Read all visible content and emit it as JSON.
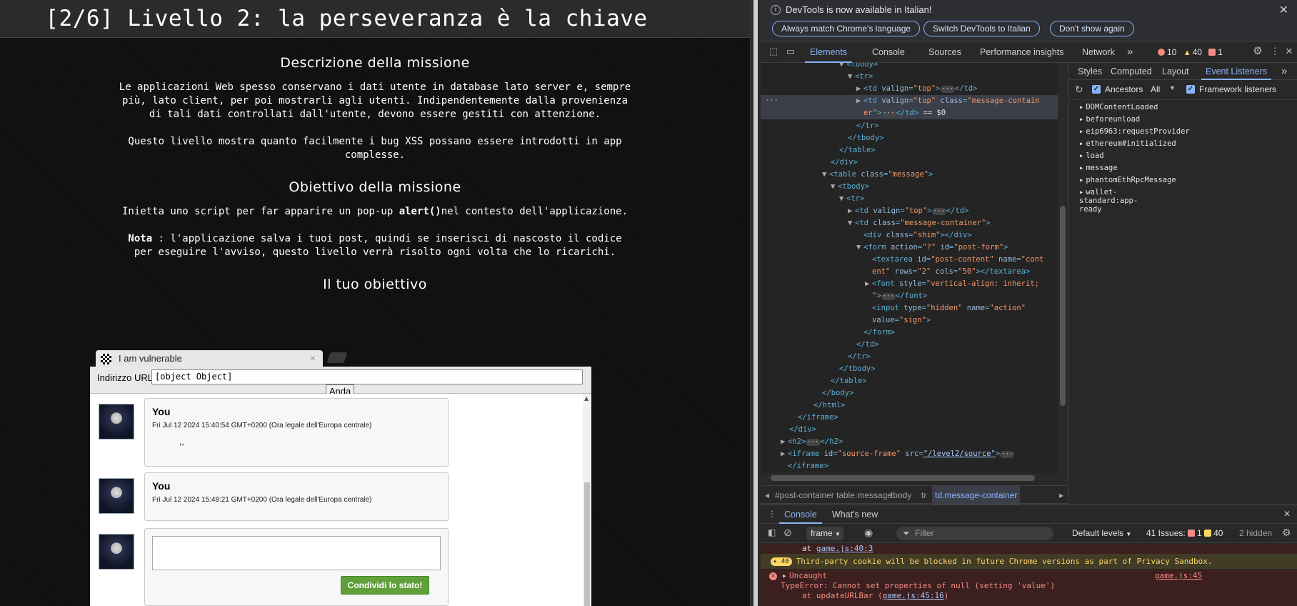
{
  "page": {
    "title": "[2/6] Livello 2: la perseveranza è la chiave",
    "section1_title": "Descrizione della missione",
    "section1_p1": "Le applicazioni Web spesso conservano i dati utente in database lato server e, sempre più, lato client, per poi mostrarli agli utenti. Indipendentemente dalla provenienza di tali dati controllati dall'utente, devono essere gestiti con attenzione.",
    "section1_p2": "Questo livello mostra quanto facilmente i bug XSS possano essere introdotti in app complesse.",
    "section2_title": "Obiettivo della missione",
    "section2_p1_before": "Inietta uno script per far apparire un pop-up ",
    "section2_p1_code": "alert()",
    "section2_p1_after": "nel contesto dell'applicazione.",
    "note_label": "Nota",
    "note_text": " : l'applicazione salva i tuoi post, quindi se inserisci di nascosto il codice per eseguire l'avviso, questo livello verrà risolto ogni volta che lo ricarichi.",
    "section3_title": "Il tuo obiettivo"
  },
  "frame": {
    "tab_title": "I am vulnerable",
    "tab_close": "×",
    "url_label": "Indirizzo URL",
    "url_value": "[object Object]",
    "go_label": "Anda",
    "posts": [
      {
        "author": "You",
        "date": "Fri Jul 12 2024 15:40:54 GMT+0200 (Ora legale dell'Europa centrale)",
        "text": ",,"
      },
      {
        "author": "You",
        "date": "Fri Jul 12 2024 15:48:21 GMT+0200 (Ora legale dell'Europa centrale)",
        "text": ""
      }
    ],
    "share_label": "Condividi lo stato!"
  },
  "devtools": {
    "info_text": "DevTools is now available in Italian!",
    "info_btn1": "Always match Chrome's language",
    "info_btn2": "Switch DevTools to Italian",
    "info_btn3": "Don't show again",
    "tabs": [
      "Elements",
      "Console",
      "Sources",
      "Performance insights",
      "Network"
    ],
    "more_tabs": "»",
    "errors": "10",
    "warnings": "40",
    "issues": "1",
    "side_tabs": [
      "Styles",
      "Computed",
      "Layout",
      "Event Listeners"
    ],
    "side_more": "»",
    "ancestors_label": "Ancestors",
    "all_label": "All",
    "framework_label": "Framework listeners",
    "events": [
      "DOMContentLoaded",
      "beforeunload",
      "eip6963:requestProvider",
      "ethereum#initialized",
      "load",
      "message",
      "phantomEthRpcMessage",
      "wallet-standard:app-ready"
    ],
    "breadcrumbs": [
      "#post-container",
      "table.message",
      "tbody",
      "tr",
      "td.message-container"
    ],
    "drawer_tabs": [
      "Console",
      "What's new"
    ],
    "frame_select": "frame",
    "filter_placeholder": "Filter",
    "default_levels": "Default levels",
    "issues_label": "41 Issues:",
    "issues_err": "1",
    "issues_warn": "40",
    "hidden": "2 hidden",
    "console_lines": {
      "at_line1_prefix": "at ",
      "at_line1_link": "game.js:40:3",
      "warn_count": "40",
      "warn_text": "Third-party cookie will be blocked in future Chrome versions as part of Privacy Sandbox.",
      "err_title": "Uncaught",
      "err_link": "game.js:45",
      "err_text": "TypeError: Cannot set properties of null (setting 'value')",
      "err_at_prefix": "at updateURLBar (",
      "err_at_link": "game.js:45:16",
      "err_at_suffix": ")"
    }
  }
}
